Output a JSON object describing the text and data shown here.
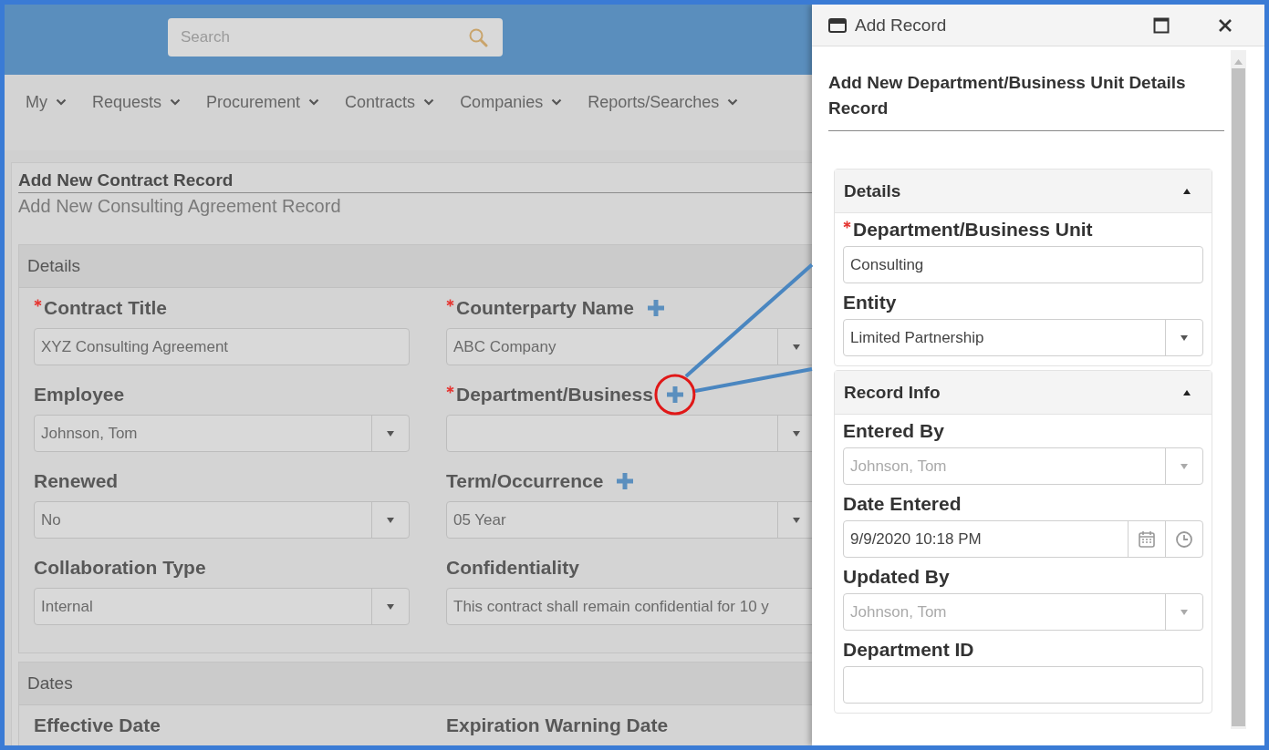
{
  "header": {
    "search": {
      "placeholder": "Search"
    }
  },
  "nav": [
    {
      "label": "My"
    },
    {
      "label": "Requests"
    },
    {
      "label": "Procurement"
    },
    {
      "label": "Contracts"
    },
    {
      "label": "Companies"
    },
    {
      "label": "Reports/Searches"
    }
  ],
  "form": {
    "title": "Add New Contract Record",
    "subtitle": "Add New Consulting Agreement Record",
    "sections": [
      {
        "title": "Details",
        "fields": [
          {
            "label": "Contract Title",
            "required": true,
            "add_button": false,
            "kind": "text",
            "value": "XYZ Consulting Agreement"
          },
          {
            "label": "Counterparty Name",
            "required": true,
            "add_button": true,
            "highlighted": false,
            "kind": "select",
            "value": "ABC Company"
          },
          {
            "label": "Employee",
            "required": false,
            "add_button": false,
            "kind": "select",
            "value": "Johnson, Tom"
          },
          {
            "label": "Department/Business",
            "required": true,
            "add_button": true,
            "highlighted": true,
            "kind": "select"
          },
          {
            "label": "Renewed",
            "required": false,
            "add_button": false,
            "kind": "select",
            "value": "No"
          },
          {
            "label": "Term/Occurrence",
            "required": false,
            "add_button": true,
            "highlighted": false,
            "kind": "select",
            "value": "05 Year"
          },
          {
            "label": "Collaboration Type",
            "required": false,
            "add_button": false,
            "kind": "select",
            "value": "Internal"
          },
          {
            "label": "Confidentiality",
            "required": false,
            "add_button": false,
            "kind": "text",
            "value": "This contract shall remain confidential for 10 y"
          }
        ]
      },
      {
        "title": "Dates",
        "fields": [
          {
            "label": "Effective Date"
          },
          {
            "label": "Expiration Warning Date"
          }
        ]
      }
    ]
  },
  "dialog": {
    "title": "Add Record",
    "heading": "Add New Department/Business Unit Details Record",
    "sections": [
      {
        "title": "Details",
        "expanded": true,
        "fields": [
          {
            "label": "Department/Business Unit",
            "required": true,
            "disabled": false,
            "kind": "text",
            "value": "Consulting"
          },
          {
            "label": "Entity",
            "required": false,
            "disabled": false,
            "kind": "select",
            "value": "Limited Partnership"
          }
        ]
      },
      {
        "title": "Record Info",
        "expanded": true,
        "fields": [
          {
            "label": "Entered By",
            "required": false,
            "disabled": true,
            "kind": "select",
            "value": "Johnson, Tom"
          },
          {
            "label": "Date Entered",
            "required": false,
            "disabled": false,
            "kind": "datetime",
            "value": "9/9/2020 10:18 PM"
          },
          {
            "label": "Updated By",
            "required": false,
            "disabled": true,
            "kind": "select",
            "value": "Johnson, Tom"
          },
          {
            "label": "Department ID",
            "required": false,
            "disabled": false,
            "kind": "text"
          }
        ]
      }
    ]
  }
}
